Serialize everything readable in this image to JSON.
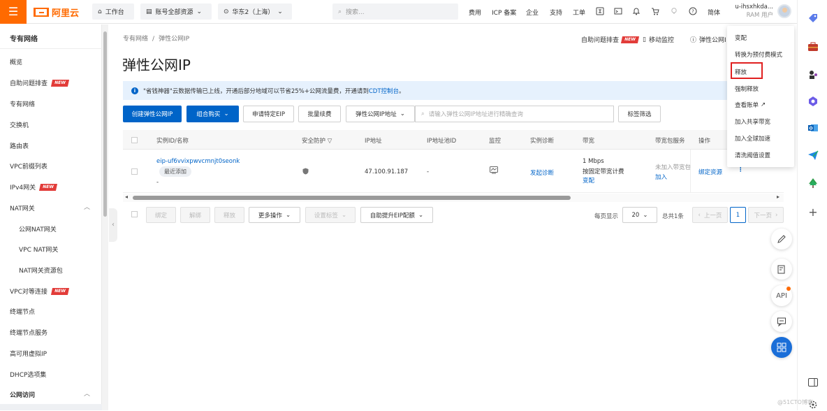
{
  "topbar": {
    "logo_text": "阿里云",
    "workbench": "工作台",
    "account_scope": "账号全部资源",
    "region": "华东2（上海）",
    "search_placeholder": "搜索...",
    "links": [
      "费用",
      "ICP 备案",
      "企业",
      "支持",
      "工单"
    ],
    "lang": "简体",
    "user_name": "u-ihsxhkda...",
    "user_role": "RAM 用户"
  },
  "sidebar": {
    "title": "专有网络",
    "items": [
      {
        "label": "概览"
      },
      {
        "label": "自助问题排查",
        "badge": "NEW"
      },
      {
        "label": "专有网络"
      },
      {
        "label": "交换机"
      },
      {
        "label": "路由表"
      },
      {
        "label": "VPC前缀列表"
      },
      {
        "label": "IPv4网关",
        "badge": "NEW"
      },
      {
        "label": "NAT网关"
      },
      {
        "label": "公网NAT网关"
      },
      {
        "label": "VPC NAT网关"
      },
      {
        "label": "NAT网关资源包"
      },
      {
        "label": "VPC对等连接",
        "badge": "NEW"
      },
      {
        "label": "终端节点"
      },
      {
        "label": "终端节点服务"
      },
      {
        "label": "高可用虚拟IP"
      },
      {
        "label": "DHCP选项集"
      },
      {
        "label": "公网访问"
      }
    ]
  },
  "breadcrumb": {
    "parent": "专有网络",
    "sep": "/",
    "current": "弹性公网IP"
  },
  "page": {
    "title": "弹性公网IP",
    "header_links": {
      "troubleshoot": "自助问题排查",
      "troubleshoot_badge": "NEW",
      "mobile": "移动监控",
      "help": "弹性公网I"
    }
  },
  "notice": {
    "text_before": "\"省钱神器\"云数据传输已上线，开通后部分地域可以节省25%+公网流量费，开通请到",
    "link": "CDT控制台",
    "text_after": "。"
  },
  "toolbar": {
    "create": "创建弹性公网IP",
    "bundle": "组合购买",
    "apply_specific": "申请特定EIP",
    "batch_renew": "批量续费",
    "filter_field": "弹性公网IP地址",
    "search_placeholder": "请输入弹性公网IP地址进行精确查询",
    "tag_filter": "标签筛选"
  },
  "table": {
    "headers": [
      "实例ID/名称",
      "安全防护",
      "IP地址",
      "IP地址池ID",
      "监控",
      "实例诊断",
      "带宽",
      "带宽包服务",
      "操作"
    ],
    "rows": [
      {
        "instance_id": "eip-uf6vvixpwvcmnjt0seonk",
        "tag": "最近添加",
        "name": "-",
        "ip": "47.100.91.187",
        "pool_id": "-",
        "diagnose": "发起诊断",
        "bandwidth": "1 Mbps",
        "billing": "按固定带宽计费",
        "change": "变配",
        "bw_package": "未加入带宽包",
        "join": "加入",
        "action": "绑定资源",
        "more": "⋮"
      }
    ]
  },
  "bottom_bar": {
    "bind": "绑定",
    "unbind": "解绑",
    "release": "释放",
    "more_ops": "更多操作",
    "set_tags": "设置标签",
    "auto_eip": "自助提升EIP配额",
    "per_page_label": "每页显示",
    "per_page": "20",
    "total": "总共1条",
    "prev": "上一页",
    "current_page": "1",
    "next": "下一页"
  },
  "dropdown_menu": {
    "items": [
      "变配",
      "转换为预付费模式",
      "释放",
      "强制释放",
      "查看账单",
      "加入共享带宽",
      "加入全球加速",
      "清洗阈值设置"
    ],
    "highlighted": "释放"
  },
  "float_buttons": {
    "api": "API"
  },
  "watermark": "@51CTO博客",
  "colors": {
    "brand": "#ff6a00",
    "primary": "#0064c8",
    "highlight_border": "#e02020",
    "new_badge": "#e23c39"
  }
}
